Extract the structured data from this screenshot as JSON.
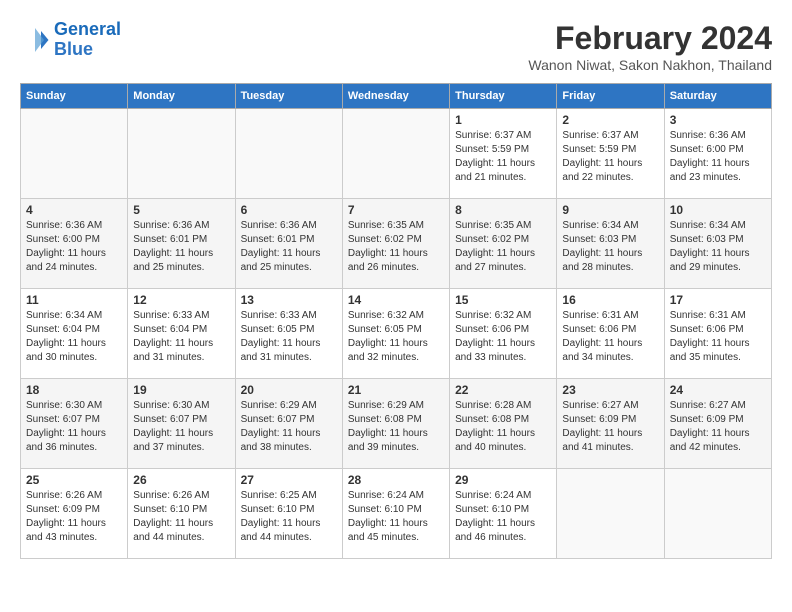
{
  "logo": {
    "line1": "General",
    "line2": "Blue"
  },
  "title": "February 2024",
  "location": "Wanon Niwat, Sakon Nakhon, Thailand",
  "days_of_week": [
    "Sunday",
    "Monday",
    "Tuesday",
    "Wednesday",
    "Thursday",
    "Friday",
    "Saturday"
  ],
  "weeks": [
    [
      {
        "day": "",
        "info": ""
      },
      {
        "day": "",
        "info": ""
      },
      {
        "day": "",
        "info": ""
      },
      {
        "day": "",
        "info": ""
      },
      {
        "day": "1",
        "info": "Sunrise: 6:37 AM\nSunset: 5:59 PM\nDaylight: 11 hours\nand 21 minutes."
      },
      {
        "day": "2",
        "info": "Sunrise: 6:37 AM\nSunset: 5:59 PM\nDaylight: 11 hours\nand 22 minutes."
      },
      {
        "day": "3",
        "info": "Sunrise: 6:36 AM\nSunset: 6:00 PM\nDaylight: 11 hours\nand 23 minutes."
      }
    ],
    [
      {
        "day": "4",
        "info": "Sunrise: 6:36 AM\nSunset: 6:00 PM\nDaylight: 11 hours\nand 24 minutes."
      },
      {
        "day": "5",
        "info": "Sunrise: 6:36 AM\nSunset: 6:01 PM\nDaylight: 11 hours\nand 25 minutes."
      },
      {
        "day": "6",
        "info": "Sunrise: 6:36 AM\nSunset: 6:01 PM\nDaylight: 11 hours\nand 25 minutes."
      },
      {
        "day": "7",
        "info": "Sunrise: 6:35 AM\nSunset: 6:02 PM\nDaylight: 11 hours\nand 26 minutes."
      },
      {
        "day": "8",
        "info": "Sunrise: 6:35 AM\nSunset: 6:02 PM\nDaylight: 11 hours\nand 27 minutes."
      },
      {
        "day": "9",
        "info": "Sunrise: 6:34 AM\nSunset: 6:03 PM\nDaylight: 11 hours\nand 28 minutes."
      },
      {
        "day": "10",
        "info": "Sunrise: 6:34 AM\nSunset: 6:03 PM\nDaylight: 11 hours\nand 29 minutes."
      }
    ],
    [
      {
        "day": "11",
        "info": "Sunrise: 6:34 AM\nSunset: 6:04 PM\nDaylight: 11 hours\nand 30 minutes."
      },
      {
        "day": "12",
        "info": "Sunrise: 6:33 AM\nSunset: 6:04 PM\nDaylight: 11 hours\nand 31 minutes."
      },
      {
        "day": "13",
        "info": "Sunrise: 6:33 AM\nSunset: 6:05 PM\nDaylight: 11 hours\nand 31 minutes."
      },
      {
        "day": "14",
        "info": "Sunrise: 6:32 AM\nSunset: 6:05 PM\nDaylight: 11 hours\nand 32 minutes."
      },
      {
        "day": "15",
        "info": "Sunrise: 6:32 AM\nSunset: 6:06 PM\nDaylight: 11 hours\nand 33 minutes."
      },
      {
        "day": "16",
        "info": "Sunrise: 6:31 AM\nSunset: 6:06 PM\nDaylight: 11 hours\nand 34 minutes."
      },
      {
        "day": "17",
        "info": "Sunrise: 6:31 AM\nSunset: 6:06 PM\nDaylight: 11 hours\nand 35 minutes."
      }
    ],
    [
      {
        "day": "18",
        "info": "Sunrise: 6:30 AM\nSunset: 6:07 PM\nDaylight: 11 hours\nand 36 minutes."
      },
      {
        "day": "19",
        "info": "Sunrise: 6:30 AM\nSunset: 6:07 PM\nDaylight: 11 hours\nand 37 minutes."
      },
      {
        "day": "20",
        "info": "Sunrise: 6:29 AM\nSunset: 6:07 PM\nDaylight: 11 hours\nand 38 minutes."
      },
      {
        "day": "21",
        "info": "Sunrise: 6:29 AM\nSunset: 6:08 PM\nDaylight: 11 hours\nand 39 minutes."
      },
      {
        "day": "22",
        "info": "Sunrise: 6:28 AM\nSunset: 6:08 PM\nDaylight: 11 hours\nand 40 minutes."
      },
      {
        "day": "23",
        "info": "Sunrise: 6:27 AM\nSunset: 6:09 PM\nDaylight: 11 hours\nand 41 minutes."
      },
      {
        "day": "24",
        "info": "Sunrise: 6:27 AM\nSunset: 6:09 PM\nDaylight: 11 hours\nand 42 minutes."
      }
    ],
    [
      {
        "day": "25",
        "info": "Sunrise: 6:26 AM\nSunset: 6:09 PM\nDaylight: 11 hours\nand 43 minutes."
      },
      {
        "day": "26",
        "info": "Sunrise: 6:26 AM\nSunset: 6:10 PM\nDaylight: 11 hours\nand 44 minutes."
      },
      {
        "day": "27",
        "info": "Sunrise: 6:25 AM\nSunset: 6:10 PM\nDaylight: 11 hours\nand 44 minutes."
      },
      {
        "day": "28",
        "info": "Sunrise: 6:24 AM\nSunset: 6:10 PM\nDaylight: 11 hours\nand 45 minutes."
      },
      {
        "day": "29",
        "info": "Sunrise: 6:24 AM\nSunset: 6:10 PM\nDaylight: 11 hours\nand 46 minutes."
      },
      {
        "day": "",
        "info": ""
      },
      {
        "day": "",
        "info": ""
      }
    ]
  ]
}
